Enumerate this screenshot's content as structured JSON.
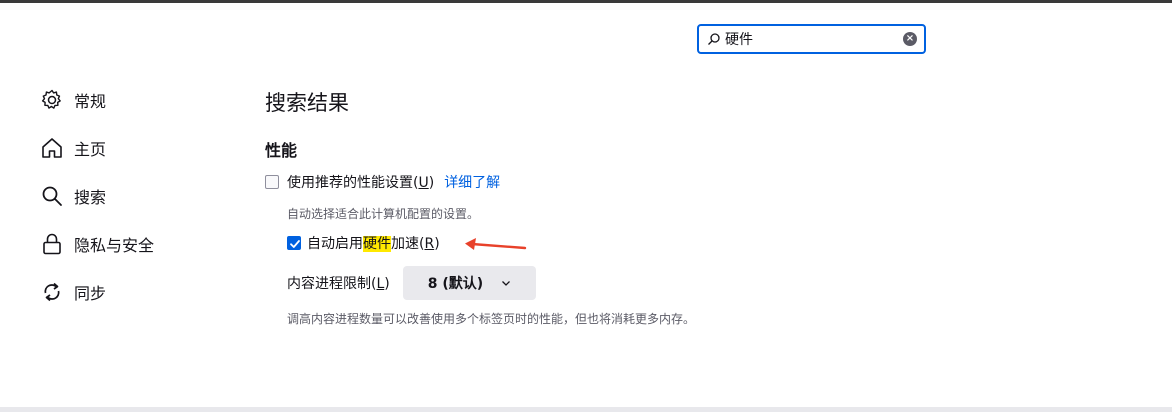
{
  "search": {
    "value": "硬件",
    "clear_label": "×"
  },
  "sidebar": {
    "items": [
      {
        "label": "常规",
        "icon": "gear-icon"
      },
      {
        "label": "主页",
        "icon": "home-icon"
      },
      {
        "label": "搜索",
        "icon": "search-icon"
      },
      {
        "label": "隐私与安全",
        "icon": "lock-icon"
      },
      {
        "label": "同步",
        "icon": "sync-icon"
      }
    ]
  },
  "main": {
    "results_title": "搜索结果",
    "section_title": "性能",
    "recommended": {
      "label": "使用推荐的性能设置(",
      "accesskey": "U",
      "label_end": ")",
      "checked": false,
      "link": "详细了解"
    },
    "recommended_desc": "自动选择适合此计算机配置的设置。",
    "hw_accel": {
      "pre": "自动启用",
      "highlight": "硬件",
      "post": "加速(",
      "accesskey": "R",
      "post_end": ")",
      "checked": true
    },
    "content_process": {
      "label": "内容进程限制(",
      "accesskey": "L",
      "label_end": ")",
      "value": "8 (默认)"
    },
    "content_process_desc": "调高内容进程数量可以改善使用多个标签页时的性能，但也将消耗更多内存。"
  },
  "colors": {
    "accent": "#0061e0",
    "highlight": "#ffe900",
    "arrow": "#e8412a"
  }
}
